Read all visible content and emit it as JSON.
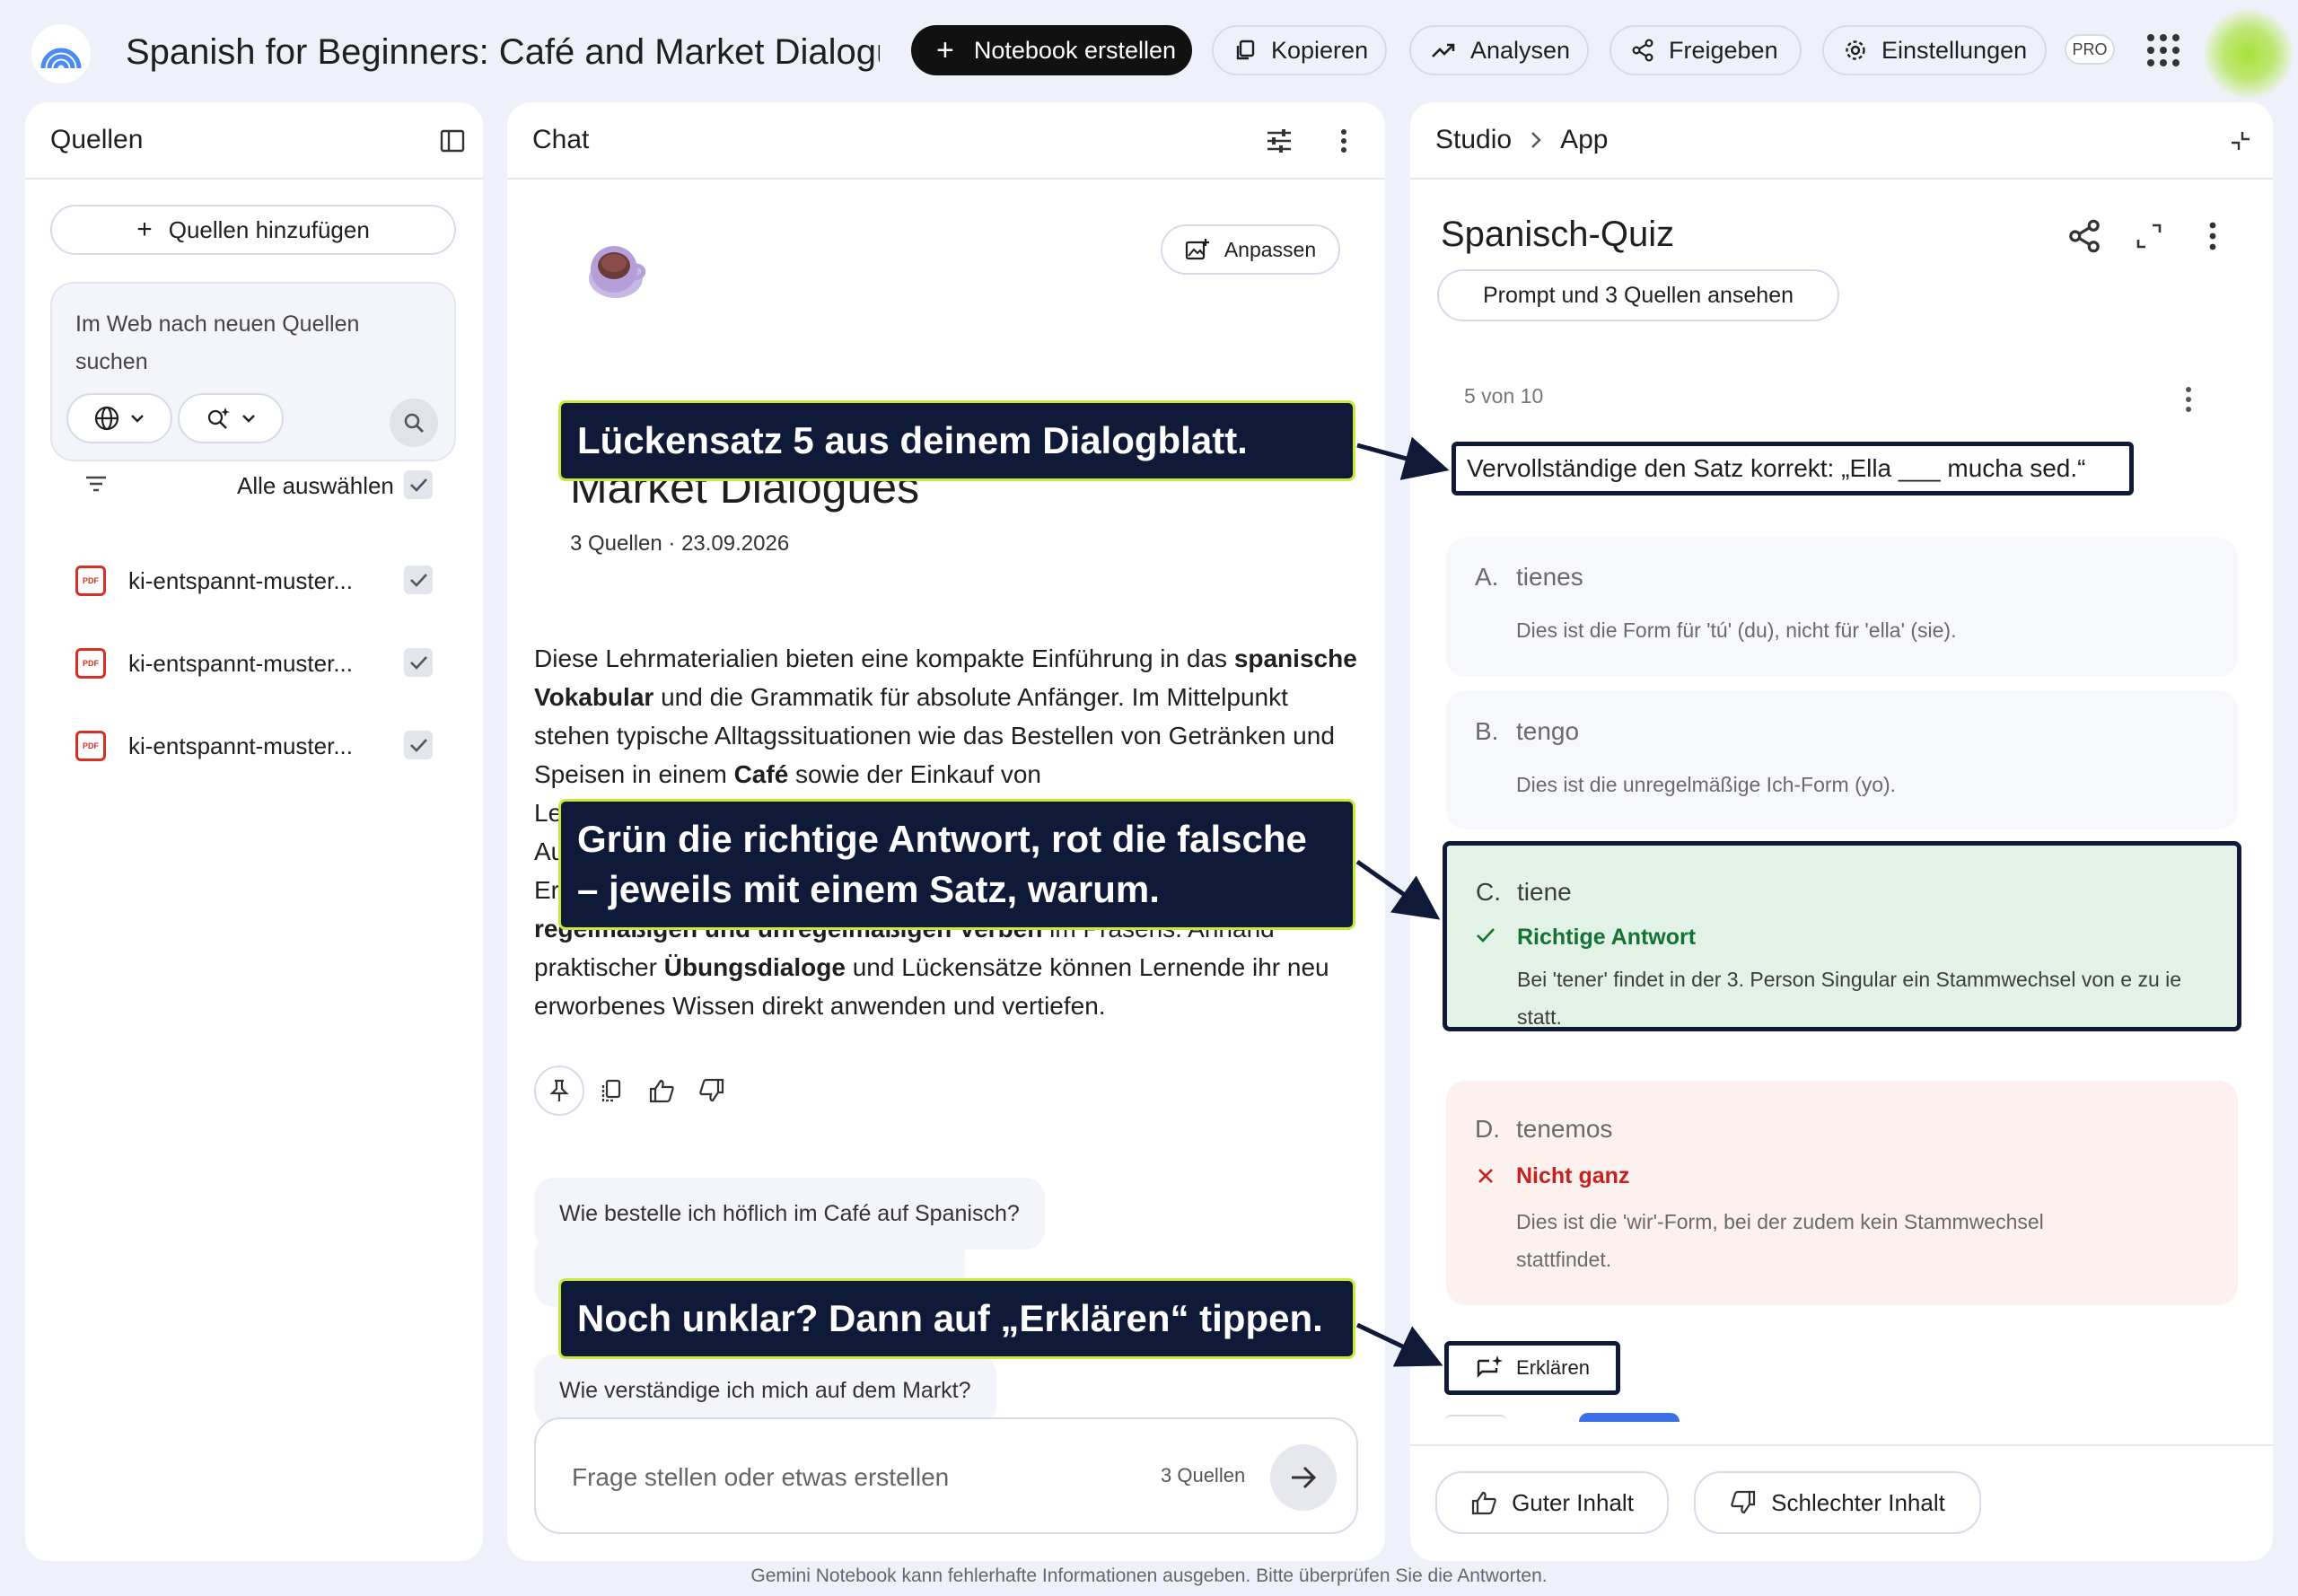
{
  "topbar": {
    "notebook_title": "Spanish for Beginners: Café and Market Dialogue",
    "create_label": "Notebook erstellen",
    "copy_label": "Kopieren",
    "analytics_label": "Analysen",
    "share_label": "Freigeben",
    "settings_label": "Einstellungen",
    "pro_label": "PRO"
  },
  "sources": {
    "title": "Quellen",
    "add_label": "Quellen hinzufügen",
    "search_text": "Im Web nach neuen Quellen suchen",
    "select_all": "Alle auswählen",
    "items": [
      {
        "label": "ki-entspannt-muster..."
      },
      {
        "label": "ki-entspannt-muster..."
      },
      {
        "label": "ki-entspannt-muster..."
      }
    ],
    "pdf_label": "PDF"
  },
  "chat": {
    "title": "Chat",
    "adjust_label": "Anpassen",
    "notebook_title_visible": "Market Dialogues",
    "meta": "3 Quellen · 23.09.2026",
    "summary": {
      "p1": "Diese Lehrmaterialien bieten eine kompakte Einführung in das ",
      "b1": "spanische Vokabular",
      "p2": " und die Grammatik für absolute Anfänger. Im Mittelpunkt stehen typische Alltagssituationen wie das Bestellen von Getränken und Speisen in einem ",
      "b2": "Café",
      "p3": " sowie der Einkauf von",
      "line5": "Le",
      "line6": "Au",
      "line7": "Er",
      "b3": "regelmäßigen und unregelmäßigen Verben",
      "p4": " im Präsens. Anhand",
      "p5": "praktischer ",
      "b4": "Übungsdialoge",
      "p6": " und Lückensätze können Lernende ihr neu erworbenes Wissen direkt anwenden und vertiefen."
    },
    "suggestions": [
      "Wie bestelle ich höflich im Café auf Spanisch?",
      "Wie verständige ich mich auf dem Markt?"
    ],
    "input_placeholder": "Frage stellen oder etwas erstellen",
    "input_sources": "3 Quellen"
  },
  "studio": {
    "crumb_root": "Studio",
    "crumb_current": "App",
    "quiz_title": "Spanisch-Quiz",
    "prompt_label": "Prompt und 3 Quellen ansehen",
    "progress": "5 von 10",
    "question": "Vervollständige den Satz korrekt: „Ella ___ mucha sed.“",
    "options": [
      {
        "letter": "A.",
        "text": "tienes",
        "explanation": "Dies ist die Form für 'tú' (du), nicht für 'ella' (sie).",
        "status": ""
      },
      {
        "letter": "B.",
        "text": "tengo",
        "explanation": "Dies ist die unregelmäßige Ich-Form (yo).",
        "status": ""
      },
      {
        "letter": "C.",
        "text": "tiene",
        "explanation": "Bei 'tener' findet in der 3. Person Singular ein Stammwechsel von e zu ie statt.",
        "status": "Richtige Antwort"
      },
      {
        "letter": "D.",
        "text": "tenemos",
        "explanation": "Dies ist die 'wir'-Form, bei der zudem kein Stammwechsel stattfindet.",
        "status": "Nicht ganz"
      }
    ],
    "explain_label": "Erklären",
    "good_label": "Guter Inhalt",
    "bad_label": "Schlechter Inhalt"
  },
  "callouts": {
    "one": "Lückensatz 5 aus deinem Dialogblatt.",
    "two": "Grün die richtige Antwort, rot die falsche\n– jeweils mit einem Satz, warum.",
    "three": "Noch unklar? Dann auf „Erklären“ tippen."
  },
  "footer": "Gemini Notebook kann fehlerhafte Informationen ausgeben. Bitte überprüfen Sie die Antworten.",
  "colors": {
    "accent_dark": "#0f1a38",
    "callout_border": "#c7ea3a",
    "correct_bg": "#e3f2e6",
    "correct_text": "#137333",
    "wrong_bg": "#fdf1f0",
    "wrong_text": "#c5221f"
  }
}
